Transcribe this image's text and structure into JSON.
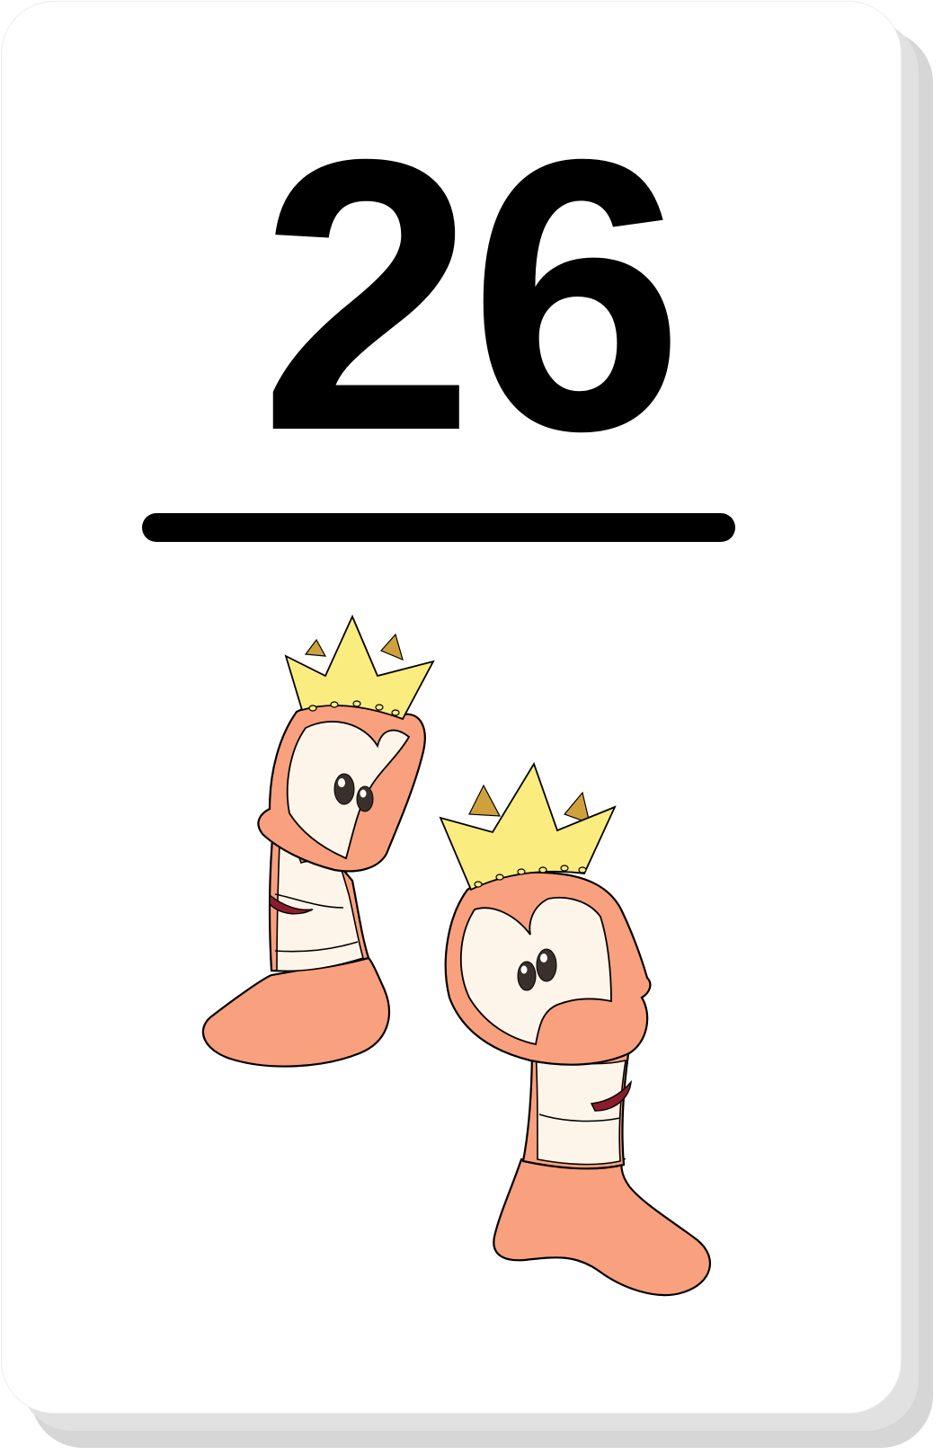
{
  "card": {
    "number": "26",
    "illustration": "two-crowned-worms"
  },
  "colors": {
    "background": "#ffffff",
    "shadow": "#d6d6d6",
    "ink": "#000000",
    "worm_body": "#f9a07e",
    "worm_belly": "#fdf5e9",
    "crown_front": "#fbec80",
    "crown_back": "#cfa13d",
    "mouth": "#8b1c2c"
  }
}
